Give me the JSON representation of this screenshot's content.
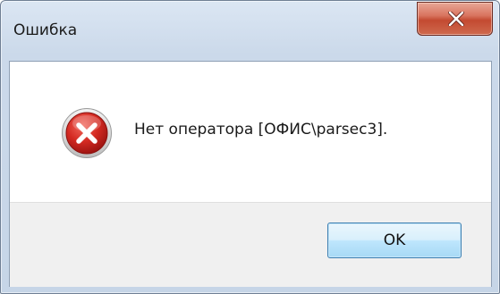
{
  "window": {
    "title": "Ошибка"
  },
  "dialog": {
    "message": "Нет оператора [ОФИС\\parsec3].",
    "ok_label": "OK"
  },
  "colors": {
    "close_button": "#c34a31",
    "error_icon": "#c81f1f",
    "button_area": "#f0f0f0"
  },
  "icons": {
    "close": "close-icon",
    "error": "error-icon"
  }
}
